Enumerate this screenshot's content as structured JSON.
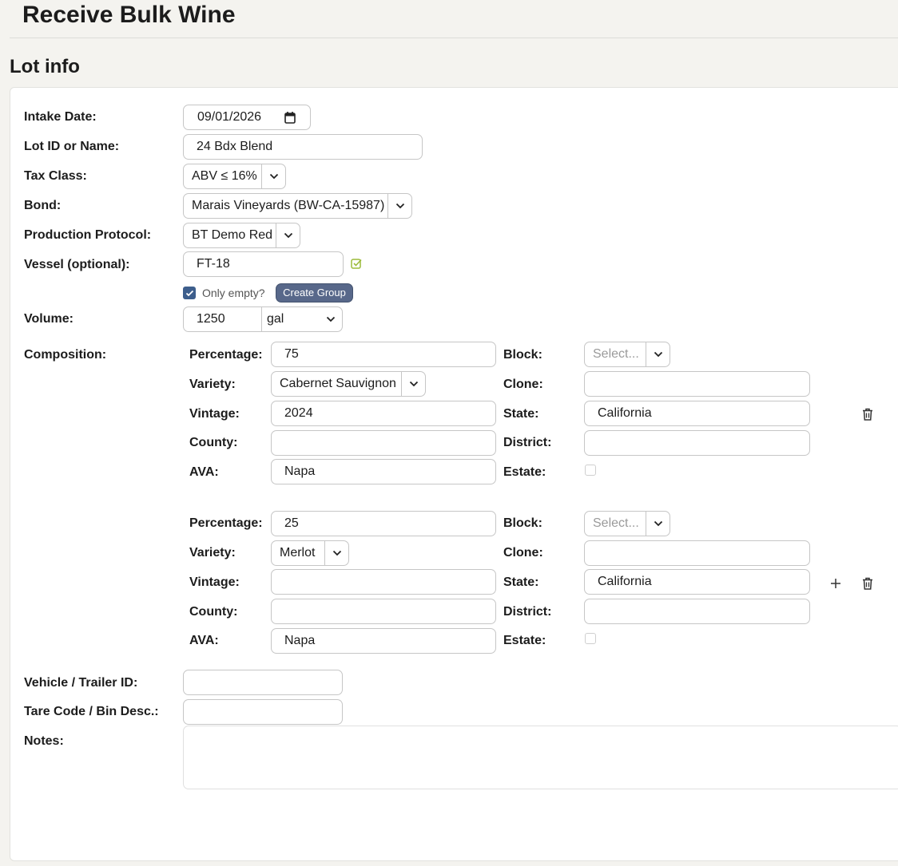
{
  "header": {
    "title": "Receive Bulk Wine"
  },
  "section": {
    "title": "Lot info"
  },
  "labels": {
    "intake_date": "Intake Date:",
    "lot_id": "Lot ID or Name:",
    "tax_class": "Tax Class:",
    "bond": "Bond:",
    "protocol": "Production Protocol:",
    "vessel": "Vessel (optional):",
    "volume": "Volume:",
    "composition": "Composition:",
    "vehicle": "Vehicle / Trailer ID:",
    "tare": "Tare Code / Bin Desc.:",
    "notes": "Notes:"
  },
  "form": {
    "intake_date": "09/01/2026",
    "lot_id": "24 Bdx Blend",
    "tax_class": "ABV ≤ 16%",
    "bond": "Marais Vineyards (BW-CA-15987)",
    "protocol": "BT Demo Red",
    "vessel": "FT-18",
    "only_empty_label": "Only empty?",
    "only_empty_checked": true,
    "create_group_label": "Create Group",
    "volume_value": "1250",
    "volume_unit": "gal",
    "vehicle": "",
    "tare": "",
    "notes": ""
  },
  "composition_labels": {
    "percentage": "Percentage:",
    "variety": "Variety:",
    "vintage": "Vintage:",
    "county": "County:",
    "ava": "AVA:",
    "block": "Block:",
    "clone": "Clone:",
    "state": "State:",
    "district": "District:",
    "estate": "Estate:"
  },
  "composition": [
    {
      "percentage": "75",
      "variety": "Cabernet Sauvignon",
      "vintage": "2024",
      "county": "",
      "ava": "Napa",
      "block_placeholder": "Select...",
      "clone": "",
      "state": "California",
      "district": "",
      "estate": false
    },
    {
      "percentage": "25",
      "variety": "Merlot",
      "vintage": "",
      "county": "",
      "ava": "Napa",
      "block_placeholder": "Select...",
      "clone": "",
      "state": "California",
      "district": "",
      "estate": false
    }
  ],
  "icons": {
    "calendar": "calendar-icon",
    "vessel_check": "check-square-icon",
    "add": "plus-icon",
    "delete": "trash-icon",
    "dropdown": "chevron-down-icon"
  },
  "colors": {
    "accent": "#3d5e8c",
    "button": "#58688a",
    "check_ok": "#9bbb3a"
  }
}
